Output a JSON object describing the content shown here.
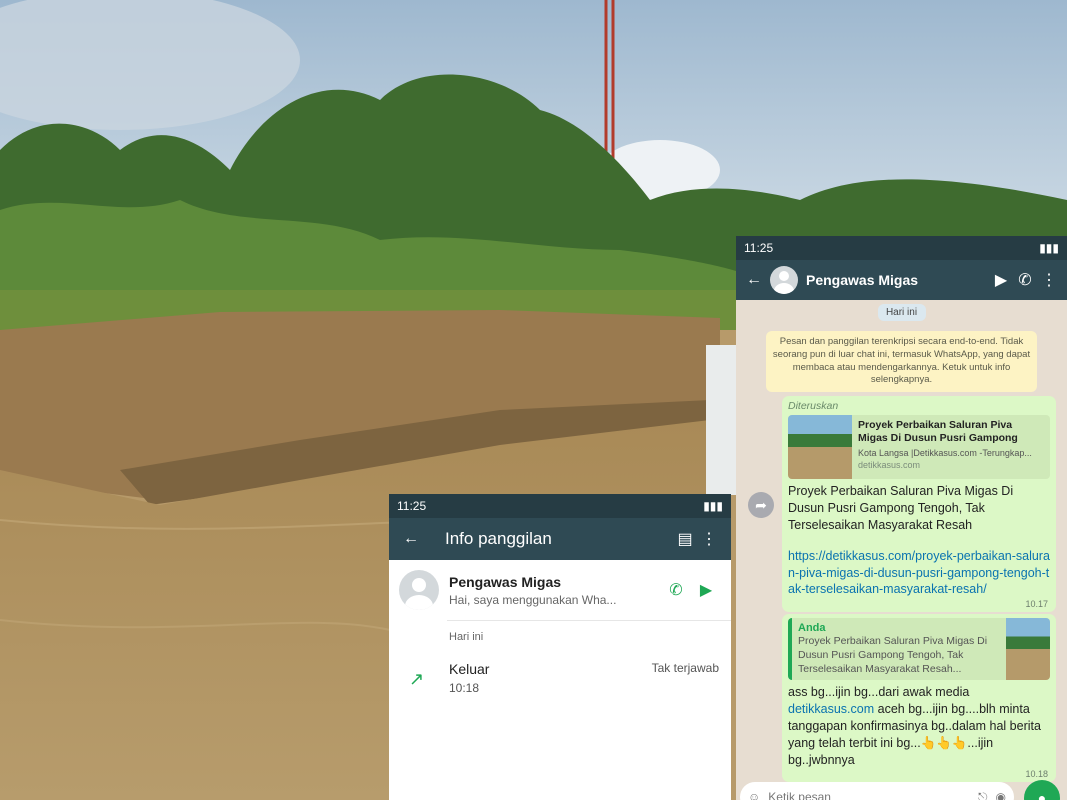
{
  "call_screen": {
    "status_time": "11:25",
    "title": "Info panggilan",
    "contact": {
      "name": "Pengawas Migas",
      "status": "Hai, saya menggunakan Wha..."
    },
    "section_label": "Hari ini",
    "entry": {
      "label": "Keluar",
      "time": "10:18",
      "result": "Tak terjawab"
    }
  },
  "chat_screen": {
    "status_time": "11:25",
    "contact_name": "Pengawas Migas",
    "date_chip": "Hari ini",
    "encryption_notice": "Pesan dan panggilan terenkripsi secara end-to-end. Tidak seorang pun di luar chat ini, termasuk WhatsApp, yang dapat membaca atau mendengarkannya. Ketuk untuk info selengkapnya.",
    "forwarded_message": {
      "forwarded_label": "Diteruskan",
      "preview_title": "Proyek Perbaikan Saluran Piva Migas Di Dusun Pusri Gampong Tengoh, T...",
      "preview_desc": "Kota Langsa |Detikkasus.com -Terungkap...",
      "preview_site": "detikkasus.com",
      "text": "Proyek Perbaikan Saluran Piva Migas Di Dusun Pusri Gampong Tengoh, Tak Terselesaikan Masyarakat Resah",
      "link": "https://detikkasus.com/proyek-perbaikan-saluran-piva-migas-di-dusun-pusri-gampong-tengoh-tak-terselesaikan-masyarakat-resah/",
      "time": "10.17"
    },
    "reply_message": {
      "quote_author": "Anda",
      "quote_text": "Proyek Perbaikan Saluran Piva Migas Di Dusun Pusri Gampong Tengoh, Tak Terselesaikan Masyarakat Resah...",
      "text_before_link": "ass bg...ijin bg...dari awak media ",
      "link_text": "detikkasus.com",
      "text_after_link": " aceh bg...ijin bg....blh minta tanggapan konfirmasinya bg..dalam hal berita yang telah terbit ini bg...👆👆👆...ijin bg..jwbnnya",
      "time": "10.18"
    },
    "input_placeholder": "Ketik pesan"
  },
  "colors": {
    "whatsapp_teal": "#2f4a54",
    "whatsapp_green": "#1fa855",
    "bubble_green": "#dcf8c6",
    "chat_bg": "#e7ddd1"
  }
}
